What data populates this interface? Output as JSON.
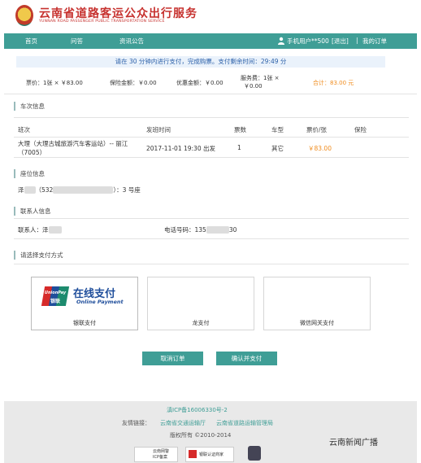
{
  "header": {
    "title": "云南省道路客运公众出行服务",
    "subtitle": "YUNNAN ROAD PASSENGER PUBLIC TRANSPORTATION SERVICE"
  },
  "nav": {
    "home": "首页",
    "faq": "问答",
    "notice": "资讯公告",
    "user": "手机用户**500",
    "logout": "[退出]",
    "sep": "|",
    "orders": "我的订单"
  },
  "countdown": "请在 30 分钟内进行支付，完成购票。支付剩余时间：29:49 分",
  "costs": {
    "ticket": "票价：1张 × ￥83.00",
    "insurance": "保险金额：￥0.00",
    "discount": "优惠金额：￥0.00",
    "service_a": "服务费：1张 ×",
    "service_b": "￥0.00",
    "total": "合计：83.00 元"
  },
  "trip": {
    "heading": "车次信息",
    "columns": [
      "班次",
      "发班时间",
      "票数",
      "车型",
      "票价/张",
      "保险"
    ],
    "row": {
      "route_a": "大理（大理古城旅游汽车客运站）-- 丽江",
      "route_b": "（7005）",
      "time": "2017-11-01 19:30 出发",
      "count": "1",
      "type": "其它",
      "price": "￥83.00",
      "insurance": ""
    }
  },
  "seat": {
    "heading": "座位信息",
    "name": "泽",
    "id_prefix": "（532",
    "id_suffix": "）：3 号座"
  },
  "contact": {
    "heading": "联系人信息",
    "label": "联系人：泽",
    "phone_label": "电话号码：135",
    "phone_suffix": "30"
  },
  "payment": {
    "heading": "请选择支付方式",
    "unionpay_logo_top": "UnionPay",
    "unionpay_logo_bottom": "银联",
    "online_title": "在线支付",
    "online_sub": "Online Payment",
    "methods": [
      "银联支付",
      "龙支付",
      "微信网关支付"
    ]
  },
  "buttons": {
    "cancel": "取消订单",
    "confirm": "确认并支付"
  },
  "footer": {
    "icp": "滇ICP备16006330号-2",
    "links_label": "友情链接：",
    "link1": "云南省交通运输厅",
    "link2": "云南省道路运输管理局",
    "copyright": "版权所有 ©2010-2014",
    "badge1": "云南网警",
    "badge1b": "ICP备案",
    "badge2": "银联认证商家",
    "watermark": "云南新闻广播"
  },
  "colors": {
    "accent": "#3f9e96",
    "brand_red": "#c7322f",
    "price": "#f08c1e"
  }
}
